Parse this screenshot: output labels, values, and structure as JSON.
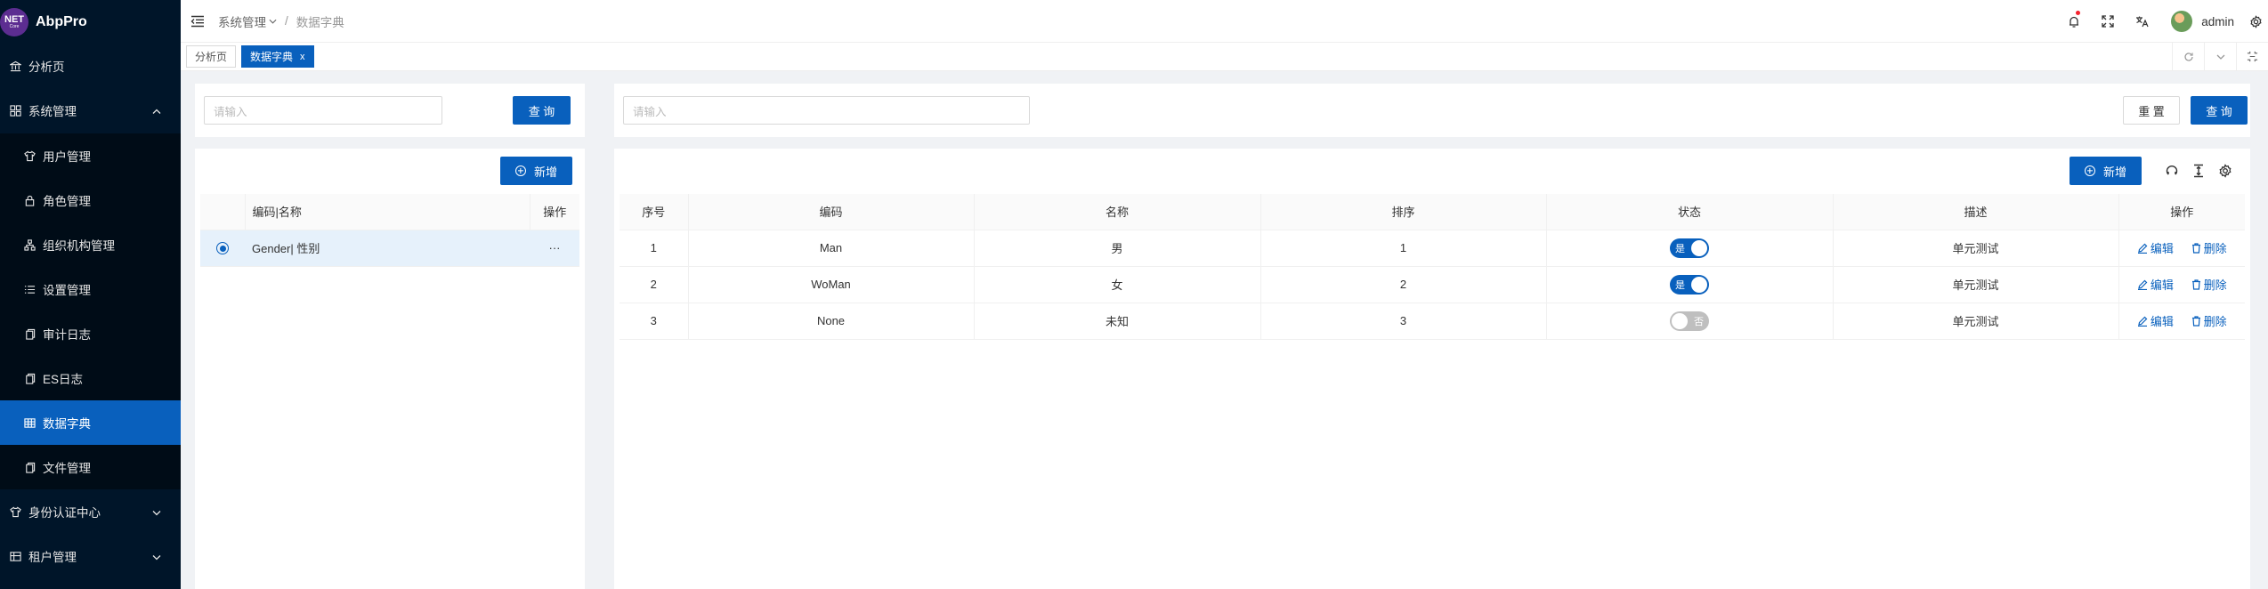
{
  "logo": {
    "badge": "NET",
    "badge_sub": "Core",
    "name": "AbpPro"
  },
  "sidebar": {
    "items": [
      {
        "label": "分析页"
      },
      {
        "label": "系统管理"
      },
      {
        "label": "用户管理"
      },
      {
        "label": "角色管理"
      },
      {
        "label": "组织机构管理"
      },
      {
        "label": "设置管理"
      },
      {
        "label": "审计日志"
      },
      {
        "label": "ES日志"
      },
      {
        "label": "数据字典"
      },
      {
        "label": "文件管理"
      },
      {
        "label": "身份认证中心"
      },
      {
        "label": "租户管理"
      }
    ]
  },
  "header": {
    "breadcrumb": [
      "系统管理",
      "数据字典"
    ],
    "username": "admin"
  },
  "tabs": [
    {
      "label": "分析页"
    },
    {
      "label": "数据字典",
      "close": "x"
    }
  ],
  "left_panel": {
    "search_placeholder": "请输入",
    "search_button": "查 询",
    "add_button": "新增",
    "columns": [
      "编码|名称",
      "操作"
    ],
    "rows": [
      {
        "text": "Gender| 性别",
        "more": "···"
      }
    ]
  },
  "right_panel": {
    "search_placeholder": "请输入",
    "reset_button": "重 置",
    "search_button": "查 询",
    "add_button": "新增",
    "columns": [
      "序号",
      "编码",
      "名称",
      "排序",
      "状态",
      "描述",
      "操作"
    ],
    "rows": [
      {
        "index": "1",
        "code": "Man",
        "name": "男",
        "sort": "1",
        "status": true,
        "status_label": "是",
        "desc": "单元测试"
      },
      {
        "index": "2",
        "code": "WoMan",
        "name": "女",
        "sort": "2",
        "status": true,
        "status_label": "是",
        "desc": "单元测试"
      },
      {
        "index": "3",
        "code": "None",
        "name": "未知",
        "sort": "3",
        "status": false,
        "status_label": "否",
        "desc": "单元测试"
      }
    ],
    "edit_label": "编辑",
    "delete_label": "删除"
  },
  "colors": {
    "primary": "#0960bd",
    "sidebar": "#001529"
  }
}
